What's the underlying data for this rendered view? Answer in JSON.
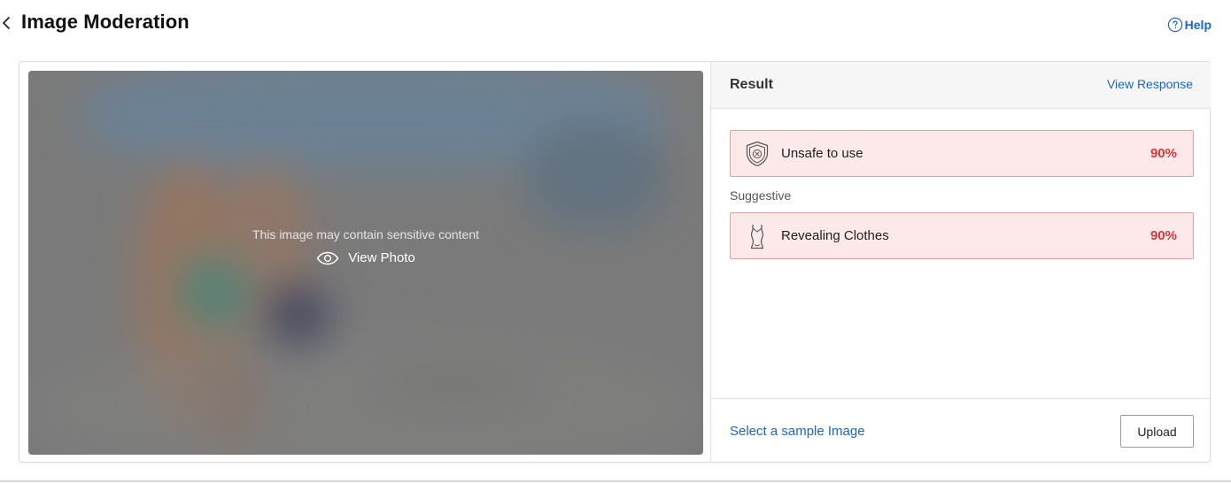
{
  "header": {
    "back_icon": "chevron-left-icon",
    "title": "Image Moderation",
    "help_icon": "question-circle-icon",
    "help_label": "Help"
  },
  "preview": {
    "sensitive_message": "This image may contain sensitive content",
    "view_photo_icon": "eye-icon",
    "view_photo_label": "View Photo"
  },
  "result": {
    "title": "Result",
    "view_response_label": "View Response",
    "verdict": {
      "icon": "shield-x-icon",
      "label": "Unsafe to use",
      "confidence": "90%"
    },
    "category": "Suggestive",
    "items": [
      {
        "icon": "swimsuit-icon",
        "label": "Revealing Clothes",
        "confidence": "90%"
      }
    ],
    "footer": {
      "sample_link_label": "Select a sample Image",
      "upload_label": "Upload"
    }
  },
  "colors": {
    "link": "#1a66c7",
    "alert_bg": "#fde9e9",
    "alert_border": "#e3a0a0",
    "alert_value": "#d13a3a"
  }
}
